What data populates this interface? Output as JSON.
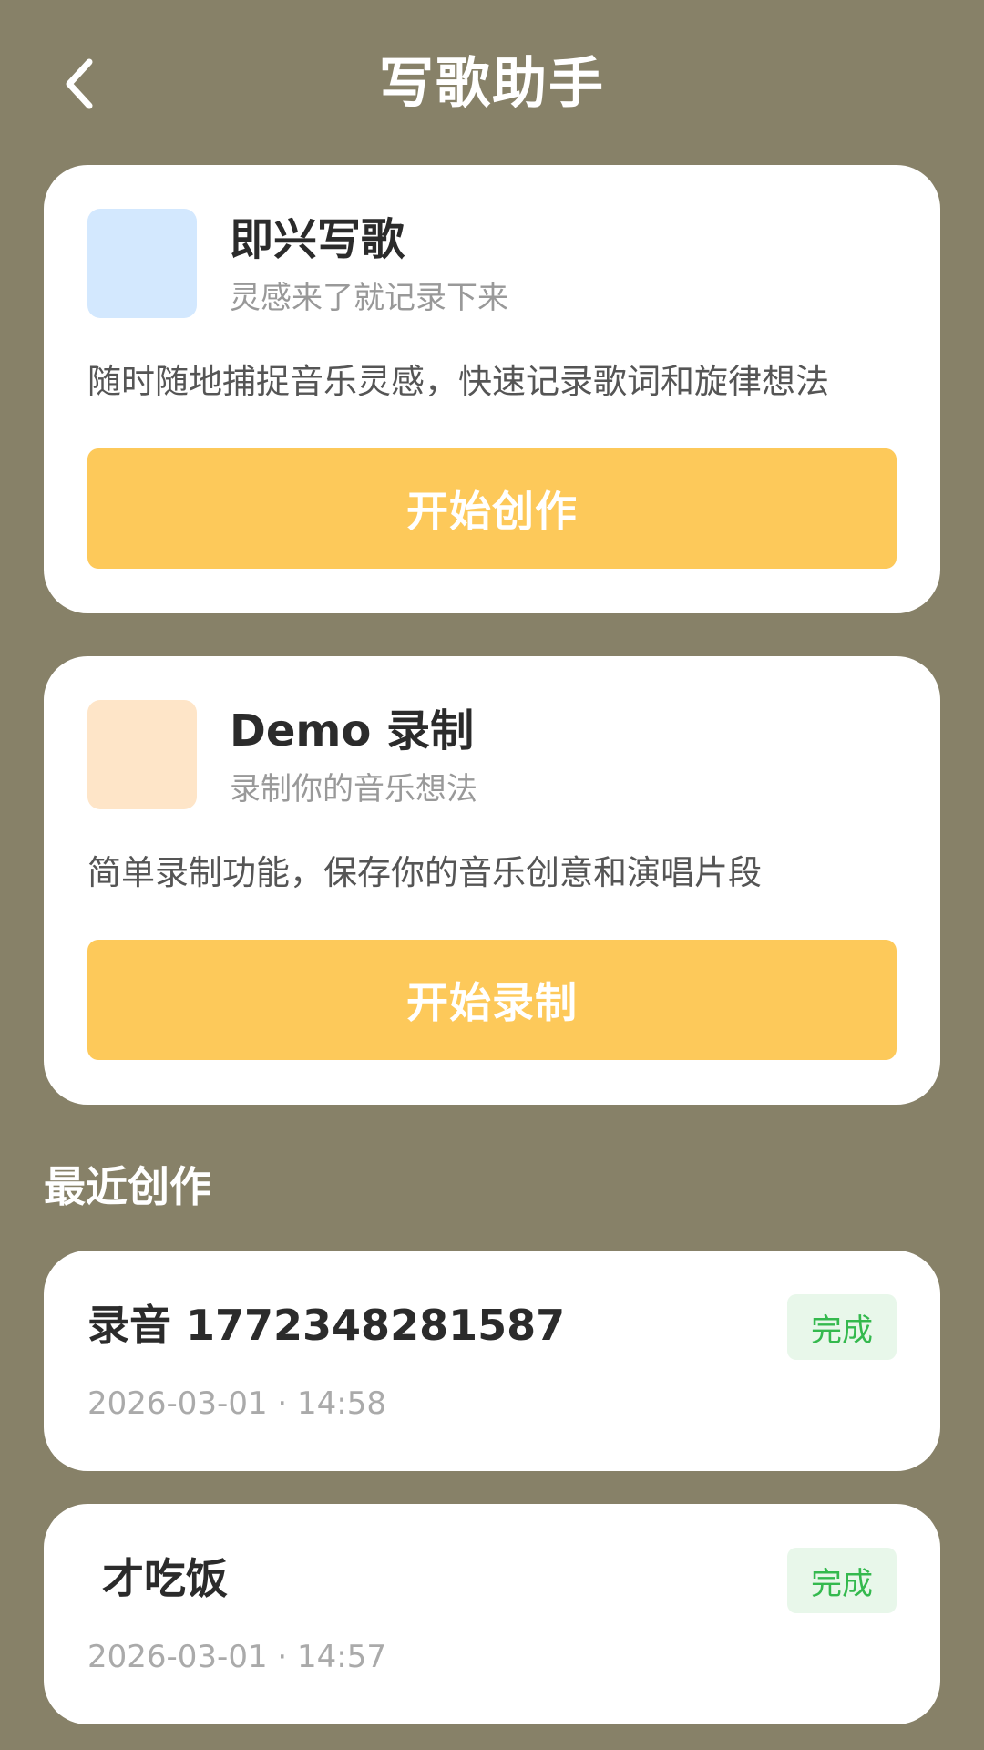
{
  "header": {
    "title": "写歌助手",
    "back_icon": "chevron-left-icon"
  },
  "colors": {
    "background": "#878168",
    "card": "#ffffff",
    "button": "#FDC95A",
    "icon_blue": "#D3E8FE",
    "icon_orange": "#FEE5C8",
    "status_text": "#34B94E",
    "status_bg": "#E8F7EA"
  },
  "features": [
    {
      "title": "即兴写歌",
      "subtitle": "灵感来了就记录下来",
      "description": "随时随地捕捉音乐灵感，快速记录歌词和旋律想法",
      "button_label": "开始创作"
    },
    {
      "title": "Demo 录制",
      "subtitle": "录制你的音乐想法",
      "description": "简单录制功能，保存你的音乐创意和演唱片段",
      "button_label": "开始录制"
    }
  ],
  "recent": {
    "section_title": "最近创作",
    "items": [
      {
        "title": "录音 1772348281587",
        "timestamp": "2026-03-01 · 14:58",
        "status": "完成"
      },
      {
        "title": " 才吃饭",
        "timestamp": "2026-03-01 · 14:57",
        "status": "完成"
      }
    ]
  }
}
